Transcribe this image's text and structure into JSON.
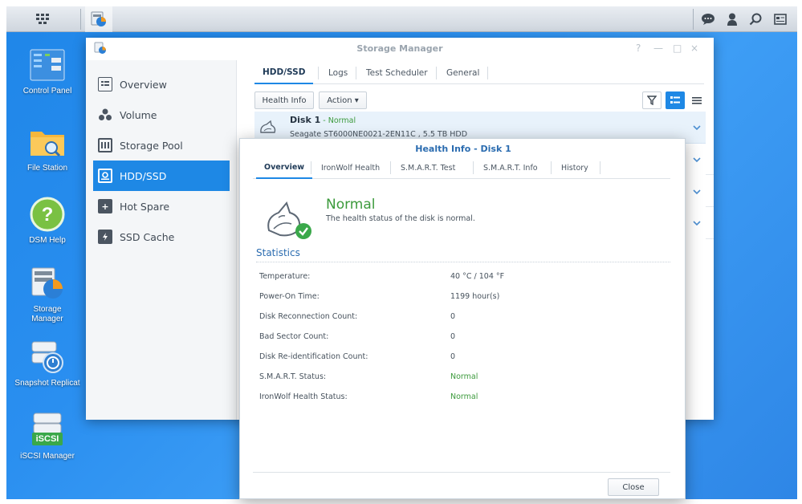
{
  "taskbar": {
    "left_icons": [
      "apps-grid-icon",
      "storage-manager-taskbar-icon"
    ],
    "right_icons": [
      "chat-icon",
      "user-icon",
      "search-icon",
      "widgets-icon"
    ]
  },
  "desktop": {
    "icons": [
      {
        "label": "Control Panel"
      },
      {
        "label": "File Station"
      },
      {
        "label": "DSM Help"
      },
      {
        "label": "Storage Manager"
      },
      {
        "label": "Snapshot Replicat"
      },
      {
        "label": "iSCSI Manager",
        "badge": "iSCSI"
      }
    ]
  },
  "window": {
    "title": "Storage Manager",
    "controls": [
      "?",
      "—",
      "□",
      "×"
    ]
  },
  "sidebar": {
    "items": [
      {
        "label": "Overview"
      },
      {
        "label": "Volume"
      },
      {
        "label": "Storage Pool"
      },
      {
        "label": "HDD/SSD",
        "active": true
      },
      {
        "label": "Hot Spare"
      },
      {
        "label": "SSD Cache"
      }
    ]
  },
  "tabs": {
    "items": [
      "HDD/SSD",
      "Logs",
      "Test Scheduler",
      "General"
    ],
    "active": "HDD/SSD"
  },
  "toolbar": {
    "health_info_label": "Health Info",
    "action_label": "Action ▾"
  },
  "disk": {
    "name": "Disk 1",
    "status": "Normal",
    "status_sep": " - ",
    "model": "Seagate ST6000NE0021-2EN11C , 5.5 TB HDD"
  },
  "dialog": {
    "title": "Health Info - Disk 1",
    "tabs": [
      "Overview",
      "IronWolf Health",
      "S.M.A.R.T. Test",
      "S.M.A.R.T. Info",
      "History"
    ],
    "active_tab": "Overview",
    "health": {
      "status": "Normal",
      "description": "The health status of the disk is normal."
    },
    "statistics_heading": "Statistics",
    "stats": [
      {
        "label": "Temperature:",
        "value": "40 °C / 104 °F"
      },
      {
        "label": "Power-On Time:",
        "value": "1199 hour(s)"
      },
      {
        "label": "Disk Reconnection Count:",
        "value": "0"
      },
      {
        "label": "Bad Sector Count:",
        "value": "0"
      },
      {
        "label": "Disk Re-identification Count:",
        "value": "0"
      },
      {
        "label": "S.M.A.R.T. Status:",
        "value": "Normal",
        "good": true
      },
      {
        "label": "IronWolf Health Status:",
        "value": "Normal",
        "good": true
      }
    ],
    "close_label": "Close"
  },
  "colors": {
    "accent": "#1e88e5",
    "good": "#3c9a3c",
    "desktop": "#2a8ff0"
  }
}
